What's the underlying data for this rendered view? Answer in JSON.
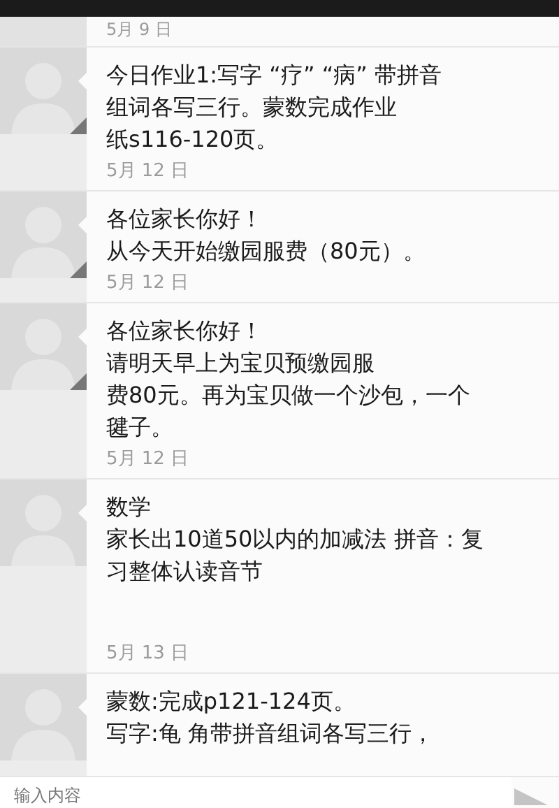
{
  "previous_date": "5月 9 日",
  "messages": [
    {
      "lines": [
        "今日作业1:写字 “疗” “病” 带拼音",
        "组词各写三行。蒙数完成作业",
        "纸s116-120页。"
      ],
      "date": "5月 12 日"
    },
    {
      "lines": [
        "各位家长你好！",
        "从今天开始缴园服费（80元）。"
      ],
      "date": "5月 12 日"
    },
    {
      "lines": [
        "各位家长你好！",
        "请明天早上为宝贝预缴园服",
        "费80元。再为宝贝做一个沙包，一个",
        "毽子。"
      ],
      "date": "5月 12 日"
    },
    {
      "lines": [
        "数学",
        "家长出10道50以内的加减法 拼音：复",
        "习整体认读音节"
      ],
      "date": "5月 13 日"
    },
    {
      "lines": [
        "蒙数:完成p121-124页。",
        "写字:龟 角带拼音组词各写三行，"
      ]
    }
  ],
  "input": {
    "placeholder": "输入内容"
  }
}
